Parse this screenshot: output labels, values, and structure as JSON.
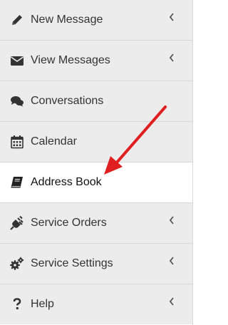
{
  "menu": {
    "items": [
      {
        "label": "New Message",
        "icon": "pencil-icon",
        "has_submenu": true,
        "active": false
      },
      {
        "label": "View Messages",
        "icon": "envelope-icon",
        "has_submenu": true,
        "active": false
      },
      {
        "label": "Conversations",
        "icon": "comments-icon",
        "has_submenu": false,
        "active": false
      },
      {
        "label": "Calendar",
        "icon": "calendar-icon",
        "has_submenu": false,
        "active": false
      },
      {
        "label": "Address Book",
        "icon": "book-icon",
        "has_submenu": false,
        "active": true
      },
      {
        "label": "Service Orders",
        "icon": "plug-icon",
        "has_submenu": true,
        "active": false
      },
      {
        "label": "Service Settings",
        "icon": "gears-icon",
        "has_submenu": true,
        "active": false
      },
      {
        "label": "Help",
        "icon": "question-icon",
        "has_submenu": true,
        "active": false
      }
    ]
  },
  "annotation": {
    "arrow_color": "#e02020",
    "points_to": "Address Book"
  },
  "colors": {
    "item_background": "#ececec",
    "active_background": "#ffffff",
    "text": "#333333",
    "divider": "#d7d7d7"
  }
}
